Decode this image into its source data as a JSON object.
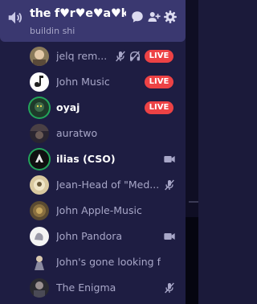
{
  "channel": {
    "name": "the f♥r♥e♥a♥k-...",
    "subtitle": "buildin shi",
    "actions": [
      "chat-bubble-icon",
      "add-member-icon",
      "gear-icon"
    ]
  },
  "colors": {
    "live": "#ed4245",
    "speaking_ring": "#23a55a",
    "channel_bg": "#3a3870",
    "panel_bg": "#1e1d42",
    "muted_text": "#a8a7c8"
  },
  "users": [
    {
      "name": "jelq rem...",
      "live": true,
      "muted": true,
      "deafened": true,
      "speaking": false,
      "bright": false
    },
    {
      "name": "John Music",
      "live": true,
      "speaking": false,
      "bright": false
    },
    {
      "name": "oyaj",
      "live": true,
      "speaking": true,
      "bright": true
    },
    {
      "name": "auratwo",
      "speaking": false,
      "bright": false
    },
    {
      "name": "ilias (CSO)",
      "video": true,
      "speaking": true,
      "bright": true
    },
    {
      "name": "Jean-Head of \"Med...",
      "muted": true,
      "speaking": false,
      "bright": false
    },
    {
      "name": "John Apple-Music",
      "speaking": false,
      "bright": false
    },
    {
      "name": "John Pandora",
      "video": true,
      "speaking": false,
      "bright": false
    },
    {
      "name": "John's gone looking for...",
      "speaking": false,
      "bright": false
    },
    {
      "name": "The Enigma",
      "muted": true,
      "speaking": false,
      "bright": false
    }
  ],
  "live_label": "LIVE"
}
